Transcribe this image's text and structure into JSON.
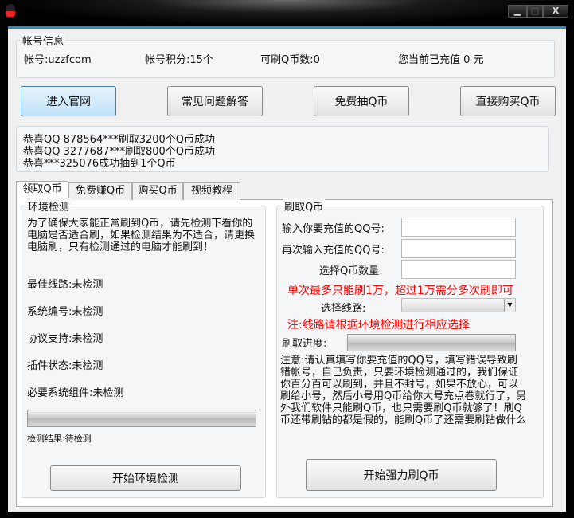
{
  "window": {
    "icon": "qq-penguin-icon",
    "min": "▁",
    "max": "□",
    "close": "X"
  },
  "account": {
    "group_label": "帐号信息",
    "account": "帐号:uzzfcom",
    "points": "帐号积分:15个",
    "coins": "可刷Q币数:0",
    "recharged": "您当前已充值 0 元"
  },
  "buttons": {
    "official": "进入官网",
    "faq": "常见问题解答",
    "free_draw": "免费抽Q币",
    "buy": "直接购买Q币"
  },
  "notices": [
    "恭喜QQ 878564***刷取3200个Q币成功",
    "恭喜QQ 3277687***刷取800个Q币成功",
    "恭喜***325076成功抽到1个Q币"
  ],
  "tabs": [
    "领取Q币",
    "免费赚Q币",
    "购买Q币",
    "视频教程"
  ],
  "env": {
    "label": "环境检测",
    "intro": "为了确保大家能正常刷到Q币，请先检测下看你的电脑是否适合刷，如果检测结果为不适合，请更换电脑刷，只有检测通过的电脑才能刷到！",
    "items": [
      "最佳线路:未检测",
      "系统编号:未检测",
      "协议支持:未检测",
      "插件状态:未检测",
      "必要系统组件:未检测"
    ],
    "result": "检测结果:待检测",
    "start": "开始环境检测",
    "progress": 0
  },
  "charge": {
    "label": "刷取Q币",
    "qq_label": "输入你要充值的QQ号:",
    "qq_value": "",
    "qq2_label": "再次输入充值的QQ号:",
    "qq2_value": "",
    "amount_label": "选择Q币数量:",
    "amount_value": "",
    "limit_note": "单次最多只能刷1万，超过1万需分多次刷即可",
    "route_label": "选择线路:",
    "route_value": "",
    "route_note": "注:线路请根据环境检测进行相应选择",
    "progress_label": "刷取进度:",
    "progress": 0,
    "notice": "注意:请认真填写你要充值的QQ号，填写错误导致刷错帐号，自己负责，只要环境检测通过的，我们保证你百分百可以刷到，并且不封号，如果不放心，可以刷给小号，然后小号用Q币给你大号充点卷就行了，另外我们软件只能刷Q币，也只需要刷Q币就够了！刷Q币还带刷钻的都是假的，能刷Q币了还需要刷钻做什么",
    "start": "开始强力刷Q币"
  }
}
